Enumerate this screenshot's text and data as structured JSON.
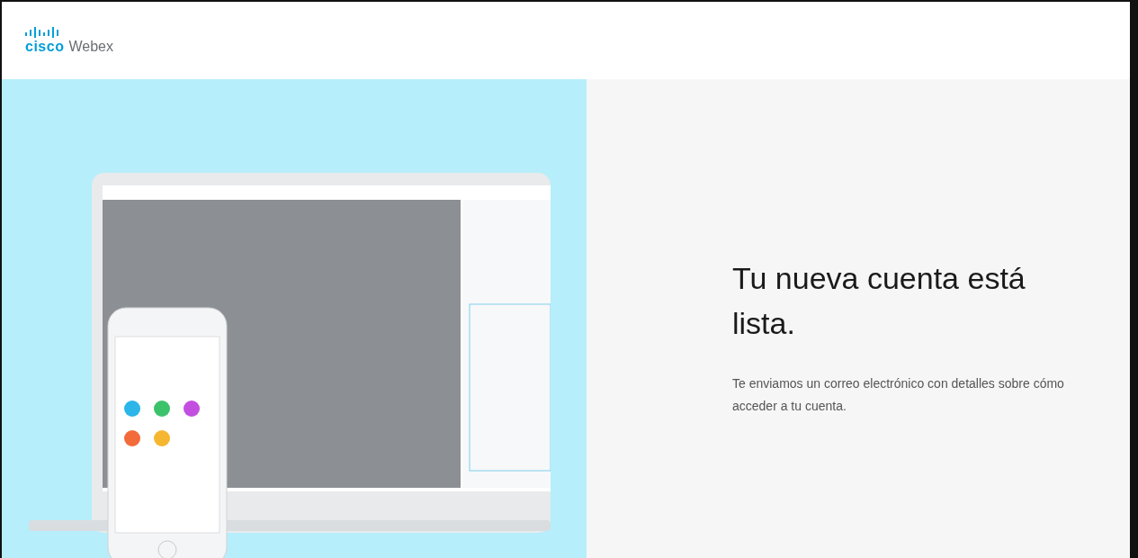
{
  "header": {
    "logo": {
      "brand": "cisco",
      "product": "Webex"
    }
  },
  "message": {
    "title": "Tu nueva cuenta está lista.",
    "body": "Te enviamos un correo electrónico con detalles sobre cómo acceder a tu cuenta."
  }
}
